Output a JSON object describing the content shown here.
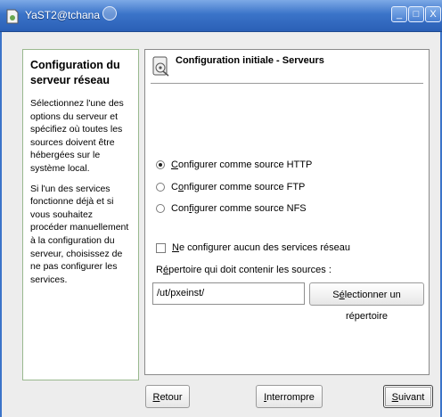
{
  "window": {
    "title": "YaST2@tchana",
    "controls": {
      "minimize": "_",
      "maximize": "□",
      "close": "X"
    }
  },
  "help": {
    "title": "Configuration du serveur réseau",
    "paragraphs": [
      "Sélectionnez l'une des options du serveur et spécifiez où toutes les sources doivent être hébergées sur le système local.",
      "Si l'un des services fonctionne déjà et si vous souhaitez procéder manuellement à la configuration du serveur, choisissez de ne pas configurer les services."
    ]
  },
  "main": {
    "title": "Configuration initiale - Serveurs",
    "radios": [
      {
        "mnemonic": "C",
        "rest": "onfigurer comme source HTTP",
        "selected": true
      },
      {
        "pre": "C",
        "mnemonic": "o",
        "rest": "nfigurer comme source FTP",
        "selected": false
      },
      {
        "pre": "Con",
        "mnemonic": "f",
        "rest": "igurer comme source NFS",
        "selected": false
      }
    ],
    "checkbox": {
      "mnemonic": "N",
      "rest": "e configurer aucun des services réseau",
      "checked": false
    },
    "dir_label": {
      "pre": "R",
      "mnemonic": "é",
      "rest": "pertoire qui doit contenir les sources :"
    },
    "dir_value": "/ut/pxeinst/",
    "browse": {
      "pre": "S",
      "mnemonic": "é",
      "rest": "lectionner un répertoire"
    }
  },
  "buttons": {
    "back": {
      "mnemonic": "R",
      "rest": "etour"
    },
    "abort": {
      "mnemonic": "I",
      "rest": "nterrompre"
    },
    "next": {
      "mnemonic": "S",
      "rest": "uivant"
    }
  },
  "colors": {
    "titlebar": "#3b74c9",
    "help_border": "#9ab98f"
  }
}
